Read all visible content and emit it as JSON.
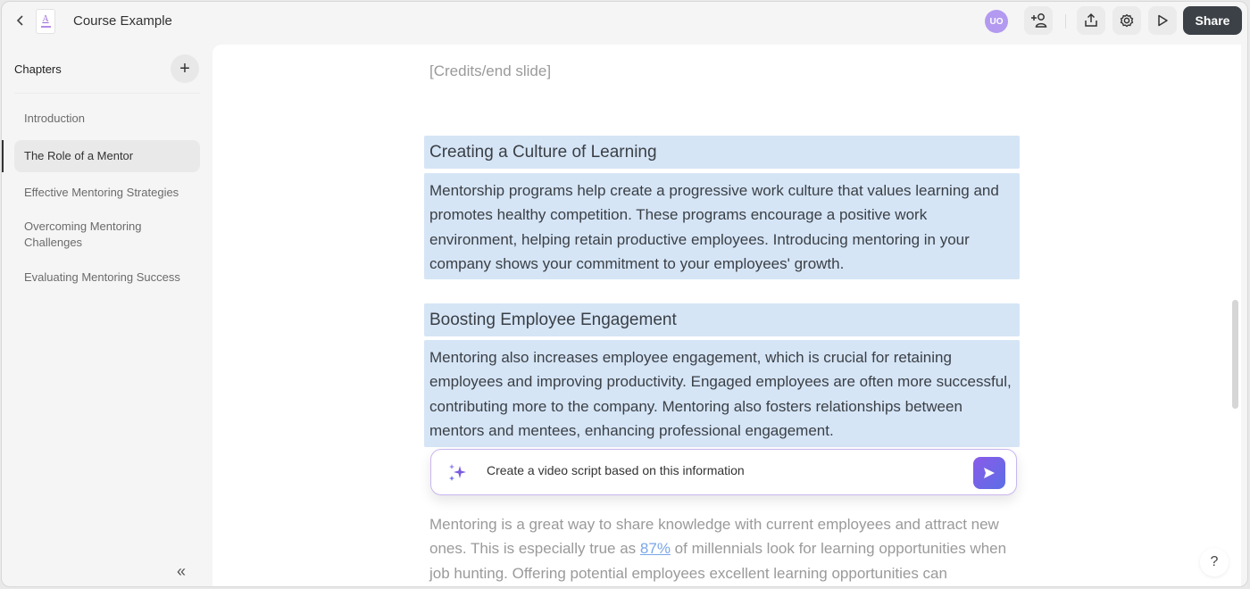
{
  "app": {
    "title": "Course Example",
    "avatar_initials": "UO",
    "share_label": "Share",
    "icons": {
      "back": "chevron-left-icon",
      "document": "document-icon",
      "add_user": "add-user-icon",
      "export": "upload-icon",
      "settings": "gear-icon",
      "preview": "play-icon"
    }
  },
  "sidebar": {
    "heading": "Chapters",
    "add_label": "+",
    "collapse_label": "«",
    "items": [
      {
        "label": "Introduction",
        "active": false
      },
      {
        "label": "The Role of a Mentor",
        "active": true
      },
      {
        "label": "Effective Mentoring Strategies",
        "active": false
      },
      {
        "label": "Overcoming Mentoring Challenges",
        "active": false
      },
      {
        "label": "Evaluating Mentoring Success",
        "active": false
      }
    ]
  },
  "editor": {
    "credits_placeholder": "[Credits/end slide]",
    "sections": [
      {
        "heading": "Creating a Culture of Learning",
        "body": "Mentorship programs help create a progressive work culture that values learning and promotes healthy competition. These programs encourage a positive work environment, helping retain productive employees. Introducing mentoring in your company shows your commitment to your employees' growth."
      },
      {
        "heading": "Boosting Employee Engagement",
        "body": "Mentoring also increases employee engagement, which is crucial for retaining employees and improving productivity. Engaged employees are often more successful, contributing more to the company. Mentoring also fosters relationships between mentors and mentees, enhancing professional engagement."
      }
    ],
    "following_text": {
      "before_link": "Mentoring is a great way to share knowledge with current employees and attract new ones. This is especially true as ",
      "link": "87%",
      "after_link": " of millennials look for learning opportunities when job hunting. Offering potential employees excellent learning opportunities can"
    }
  },
  "ai_prompt": {
    "value": "Create a video script based on this information",
    "icon": "sparkle-icon",
    "send_icon": "send-icon",
    "accent": "#7a5ae0"
  },
  "help_label": "?"
}
